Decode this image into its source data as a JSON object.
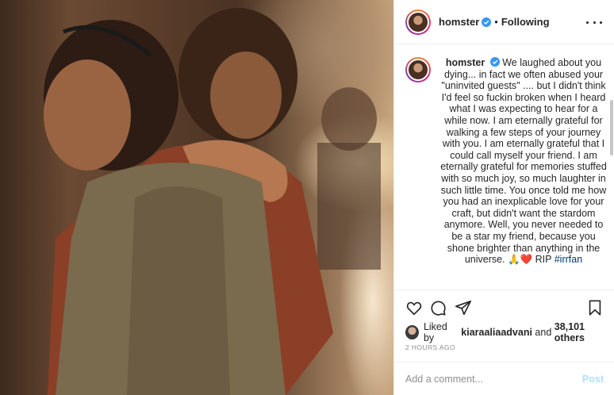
{
  "post": {
    "username": "homster",
    "following_label": "Following",
    "separator": "•",
    "caption_segments": [
      "We laughed about you dying... in fact we often abused your \"uninvited guests\" .... but I didn't think I'd feel so fuckin broken when I heard what I was expecting to hear for a while now. I am eternally grateful for walking a few steps of your journey with you. I am eternally grateful that I could call myself your friend. I am eternally grateful for memories stuffed with so much joy, so much laughter in such little time. You once told me how you had an inexplicable love for your craft, but didn't want the stardom anymore. Well, you never needed to be a star my friend, because you shone brighter than anything in the universe. ",
      "🙏❤️ RIP ",
      "#irrfan"
    ],
    "liked_by_prefix": "Liked by",
    "liked_by_user": "kiaraaliaadvani",
    "liked_by_and": "and",
    "liked_by_count": "38,101 others",
    "timestamp": "2 HOURS AGO",
    "comment_placeholder": "Add a comment...",
    "post_button": "Post"
  },
  "icons": {
    "verified": "verified-badge-icon",
    "more": "more-options-icon",
    "like": "heart-icon",
    "comment": "comment-icon",
    "share": "share-icon",
    "save": "bookmark-icon"
  },
  "colors": {
    "verified": "#3897f0",
    "link": "#00376b",
    "post_disabled": "#b2dffc",
    "muted": "#8e8e8e"
  }
}
